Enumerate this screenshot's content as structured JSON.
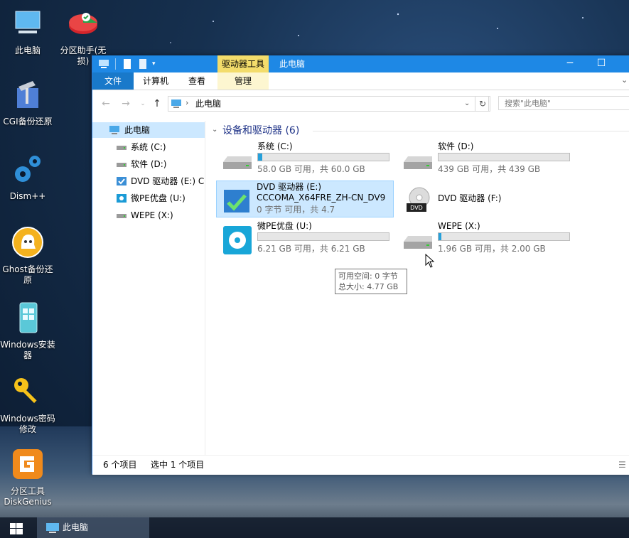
{
  "desktop": {
    "icons": [
      {
        "label": "此电脑",
        "icon": "computer-icon"
      },
      {
        "label": "分区助手(无损)",
        "icon": "partition-assistant-icon"
      },
      {
        "label": "CGI备份还原",
        "icon": "cgi-backup-icon"
      },
      {
        "label": "Dism++",
        "icon": "gear-icon"
      },
      {
        "label": "Ghost备份还原",
        "icon": "ghost-icon"
      },
      {
        "label": "Windows安装器",
        "icon": "installer-icon"
      },
      {
        "label": "Windows密码修改",
        "icon": "key-icon"
      },
      {
        "label": "分区工具DiskGenius",
        "icon": "diskgenius-icon"
      }
    ]
  },
  "window": {
    "context_tool_group": "驱动器工具",
    "title": "此电脑",
    "tabs": {
      "file": "文件",
      "computer": "计算机",
      "view": "查看",
      "manage": "管理"
    },
    "address": {
      "path": "此电脑"
    },
    "search": {
      "placeholder": "搜索\"此电脑\""
    },
    "nav": {
      "items": [
        {
          "label": "此电脑",
          "icon": "computer-icon"
        },
        {
          "label": "系统 (C:)",
          "icon": "drive-icon"
        },
        {
          "label": "软件 (D:)",
          "icon": "drive-icon"
        },
        {
          "label": "DVD 驱动器 (E:) CC",
          "icon": "dvd-icon"
        },
        {
          "label": "微PE优盘 (U:)",
          "icon": "usb-disk-icon"
        },
        {
          "label": "WEPE (X:)",
          "icon": "drive-icon"
        }
      ]
    },
    "content": {
      "group_title": "设备和驱动器 (6)",
      "drives": [
        {
          "name": "系统 (C:)",
          "free_text": "58.0 GB 可用，共 60.0 GB",
          "used_fraction": 0.033
        },
        {
          "name": "软件 (D:)",
          "free_text": "439 GB 可用，共 439 GB",
          "used_fraction": 0.0
        },
        {
          "name": "DVD 驱动器 (E:)",
          "name2": "CCCOMA_X64FRE_ZH-CN_DV9",
          "free_text": "0 字节 可用，共 4.7",
          "used_fraction": 1.0
        },
        {
          "name": "DVD 驱动器 (F:)",
          "badge": "DVD"
        },
        {
          "name": "微PE优盘 (U:)",
          "free_text": "6.21 GB 可用，共 6.21 GB",
          "used_fraction": 0.0
        },
        {
          "name": "WEPE (X:)",
          "free_text": "1.96 GB 可用，共 2.00 GB",
          "used_fraction": 0.02
        }
      ],
      "tooltip": {
        "line1": "可用空间: 0 字节",
        "line2": "总大小: 4.77 GB"
      }
    },
    "status": {
      "count": "6 个项目",
      "selected": "选中 1 个项目"
    }
  },
  "taskbar": {
    "task_label": "此电脑"
  }
}
